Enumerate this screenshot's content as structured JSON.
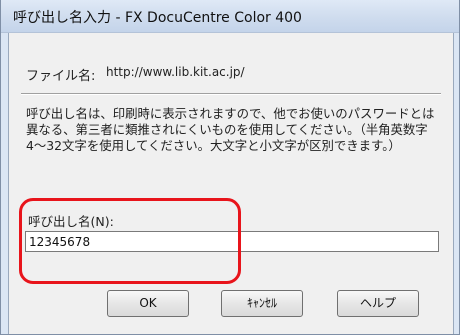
{
  "window": {
    "title": "呼び出し名入力 - FX DocuCentre Color 400"
  },
  "file": {
    "label": "ファイル名:",
    "value": "http://www.lib.kit.ac.jp/"
  },
  "description": "呼び出し名は、印刷時に表示されますので、他でお使いのパスワードとは異なる、第三者に類推されにくいものを使用してください。（半角英数字4〜32文字を使用してください。大文字と小文字が区別できます。）",
  "call_name": {
    "label": "呼び出し名(N):",
    "value": "12345678"
  },
  "buttons": {
    "ok": "OK",
    "cancel": "ｷｬﾝｾﾙ",
    "help": "ヘルプ"
  },
  "colors": {
    "highlight": "#e8141b",
    "titlebar": "#cfdcee",
    "dialog_bg": "#f0f0f0"
  }
}
